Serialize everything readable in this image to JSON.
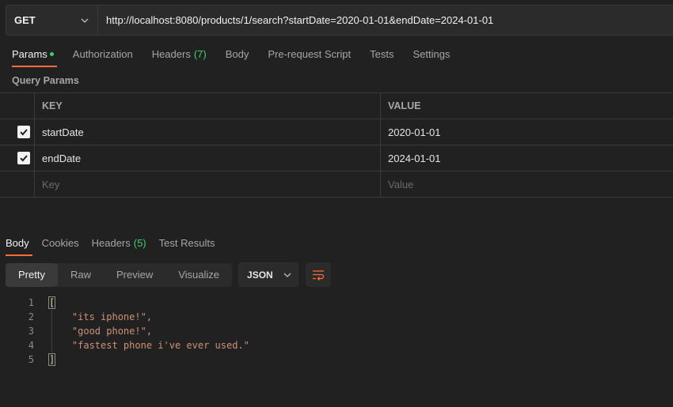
{
  "request": {
    "method": "GET",
    "url": "http://localhost:8080/products/1/search?startDate=2020-01-01&endDate=2024-01-01"
  },
  "request_tabs": [
    {
      "label": "Params",
      "active": true,
      "indicator": "dot"
    },
    {
      "label": "Authorization"
    },
    {
      "label": "Headers",
      "count": "(7)"
    },
    {
      "label": "Body"
    },
    {
      "label": "Pre-request Script"
    },
    {
      "label": "Tests"
    },
    {
      "label": "Settings"
    }
  ],
  "query_params": {
    "title": "Query Params",
    "headers": {
      "key": "KEY",
      "value": "VALUE"
    },
    "rows": [
      {
        "checked": true,
        "key": "startDate",
        "value": "2020-01-01"
      },
      {
        "checked": true,
        "key": "endDate",
        "value": "2024-01-01"
      }
    ],
    "placeholder": {
      "key": "Key",
      "value": "Value"
    }
  },
  "response_tabs": [
    {
      "label": "Body",
      "active": true
    },
    {
      "label": "Cookies"
    },
    {
      "label": "Headers",
      "count": "(5)"
    },
    {
      "label": "Test Results"
    }
  ],
  "view_modes": [
    "Pretty",
    "Raw",
    "Preview",
    "Visualize"
  ],
  "active_view": "Pretty",
  "format": "JSON",
  "code": {
    "line_numbers": [
      "1",
      "2",
      "3",
      "4",
      "5"
    ],
    "open": "[",
    "items": [
      "\"its iphone!\",",
      "\"good phone!\",",
      "\"fastest phone i've ever used.\""
    ],
    "close": "]"
  },
  "colors": {
    "accent": "#ff6c37",
    "indicator": "#3ccf6b",
    "string": "#ce9178"
  },
  "icons": {
    "method_dropdown": "chevron-down-icon",
    "format_dropdown": "chevron-down-icon",
    "wrap": "wrap-lines-icon",
    "check": "checkmark-icon"
  }
}
